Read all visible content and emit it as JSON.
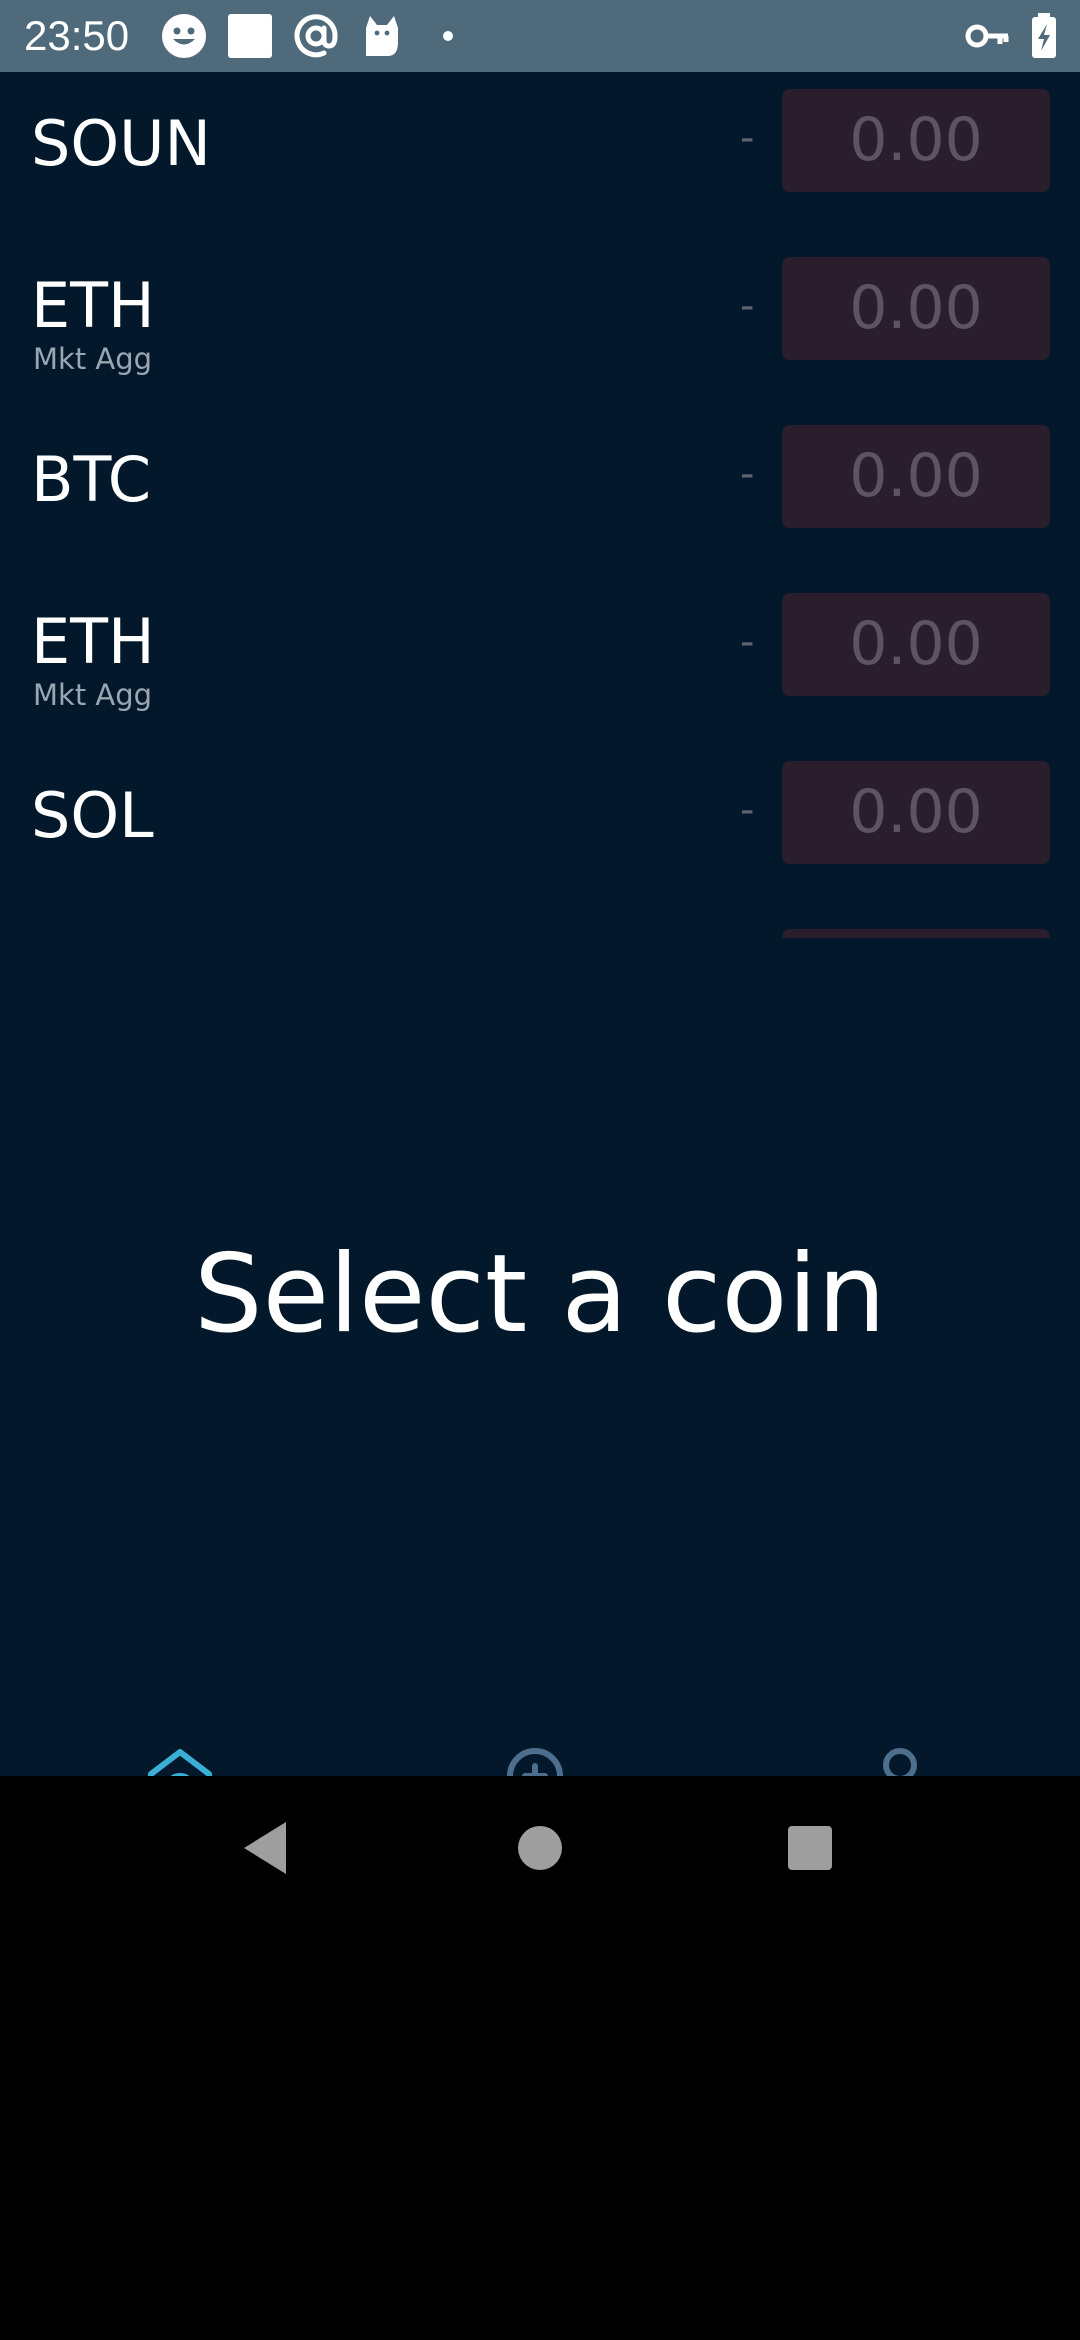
{
  "status_bar": {
    "time": "23:50",
    "left_icons": [
      "smiley-icon",
      "white-square-icon",
      "at-sign-icon",
      "cat-icon",
      "dot-icon"
    ],
    "right_icons": [
      "key-icon",
      "battery-charging-icon"
    ]
  },
  "coins": [
    {
      "symbol": "SOUN",
      "sub": "",
      "change": "-",
      "value": "0.00"
    },
    {
      "symbol": "ETH",
      "sub": "Mkt Agg",
      "change": "-",
      "value": "0.00"
    },
    {
      "symbol": "BTC",
      "sub": "",
      "change": "-",
      "value": "0.00"
    },
    {
      "symbol": "ETH",
      "sub": "Mkt Agg",
      "change": "-",
      "value": "0.00"
    },
    {
      "symbol": "SOL",
      "sub": "",
      "change": "-",
      "value": "0.00"
    }
  ],
  "detail": {
    "placeholder": "Select a coin"
  },
  "bottom_nav": {
    "items": [
      {
        "icon": "home-icon",
        "active": true
      },
      {
        "icon": "zoom-in-icon",
        "active": false
      },
      {
        "icon": "profile-icon",
        "active": false
      }
    ]
  },
  "system_nav": [
    "back-icon",
    "home-circle-icon",
    "recents-icon"
  ],
  "colors": {
    "status_bar": "#4f6a7a",
    "app_background": "#03182a",
    "value_box": "#2a1e2c",
    "nav_active": "#3aaed4",
    "nav_inactive": "#4d6e8c"
  }
}
